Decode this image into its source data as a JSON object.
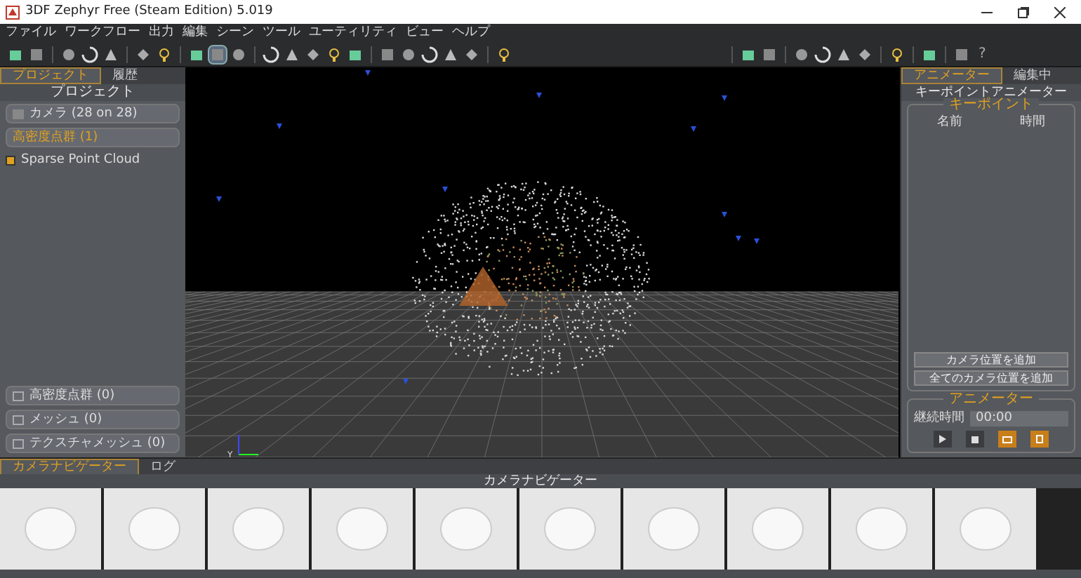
{
  "window": {
    "title": "3DF Zephyr Free (Steam Edition) 5.019"
  },
  "menu": [
    "ファイル",
    "ワークフロー",
    "出力",
    "編集",
    "シーン",
    "ツール",
    "ユーティリティ",
    "ビュー",
    "ヘルプ"
  ],
  "toolbar": [
    [
      {
        "selected": false
      },
      {
        "selected": false
      }
    ],
    [
      {
        "selected": false
      },
      {
        "selected": false
      },
      {
        "selected": false
      }
    ],
    [
      {
        "selected": false
      },
      {
        "selected": false
      }
    ],
    [
      {
        "selected": false
      },
      {
        "selected": true
      },
      {
        "selected": false
      }
    ],
    [
      {
        "selected": false
      },
      {
        "selected": false
      },
      {
        "selected": false
      },
      {
        "selected": false
      },
      {
        "selected": false
      }
    ],
    [
      {
        "selected": false
      },
      {
        "selected": false
      },
      {
        "selected": false
      },
      {
        "selected": false
      },
      {
        "selected": false
      }
    ],
    [
      {
        "selected": false
      }
    ],
    [
      {
        "selected": false
      },
      {
        "selected": false
      }
    ],
    [
      {
        "selected": false
      },
      {
        "selected": false
      },
      {
        "selected": false
      },
      {
        "selected": false
      }
    ],
    [
      {
        "selected": false
      }
    ],
    [
      {
        "selected": false
      }
    ],
    [
      {
        "selected": false
      }
    ]
  ],
  "help_button": "?",
  "left_panel": {
    "tabs": [
      {
        "label": "プロジェクト",
        "selected": true
      },
      {
        "label": "履歴",
        "selected": false
      }
    ],
    "header": "プロジェクト",
    "items": [
      {
        "label": "カメラ (28 on 28)",
        "highlighted": false
      },
      {
        "label": "高密度点群 (1)",
        "highlighted": true
      }
    ],
    "cloud": {
      "label": "Sparse Point Cloud",
      "checked": true
    },
    "bottom_items": [
      {
        "label": "高密度点群 (0)"
      },
      {
        "label": "メッシュ (0)"
      },
      {
        "label": "テクスチャメッシュ (0)"
      }
    ]
  },
  "right_panel": {
    "tabs": [
      {
        "label": "アニメーター",
        "selected": true
      },
      {
        "label": "編集中",
        "selected": false
      }
    ],
    "header": "キーポイントアニメーター",
    "keypoints": {
      "title": "キーポイント",
      "columns": [
        "名前",
        "時間"
      ],
      "buttons": [
        "カメラ位置を追加",
        "全てのカメラ位置を追加"
      ]
    },
    "animator": {
      "title": "アニメーター",
      "duration_label": "継続時間",
      "duration_value": "00:00"
    }
  },
  "bottom_panel": {
    "tabs": [
      {
        "label": "カメラナビゲーター",
        "selected": true
      },
      {
        "label": "ログ",
        "selected": false
      }
    ],
    "header": "カメラナビゲーター"
  },
  "viewport": {
    "axis_label": "Y"
  }
}
